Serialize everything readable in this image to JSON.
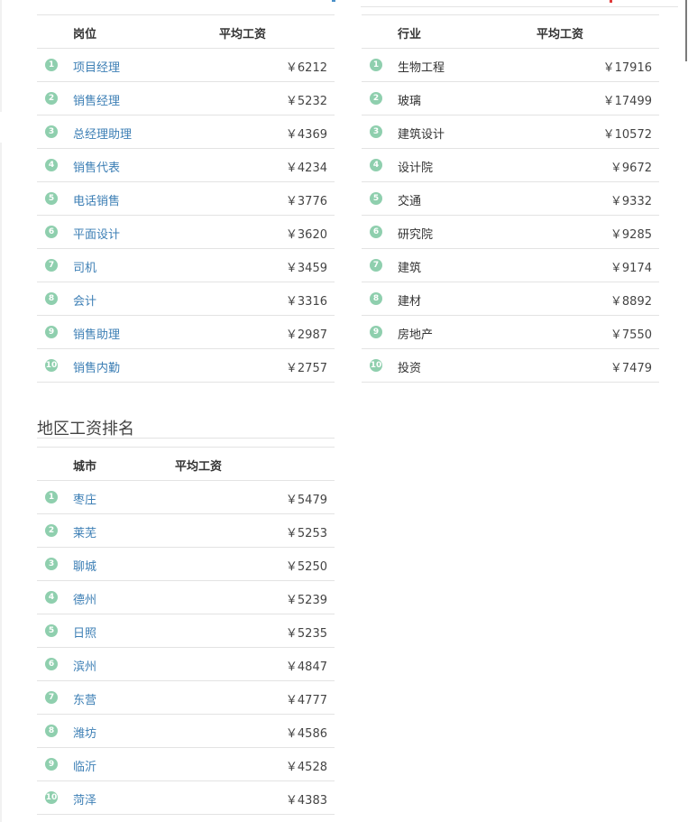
{
  "positions": {
    "col_name": "岗位",
    "col_salary": "平均工资",
    "rows": [
      {
        "rank": "1",
        "name": "项目经理",
        "salary": "￥6212"
      },
      {
        "rank": "2",
        "name": "销售经理",
        "salary": "￥5232"
      },
      {
        "rank": "3",
        "name": "总经理助理",
        "salary": "￥4369"
      },
      {
        "rank": "4",
        "name": "销售代表",
        "salary": "￥4234"
      },
      {
        "rank": "5",
        "name": "电话销售",
        "salary": "￥3776"
      },
      {
        "rank": "6",
        "name": "平面设计",
        "salary": "￥3620"
      },
      {
        "rank": "7",
        "name": "司机",
        "salary": "￥3459"
      },
      {
        "rank": "8",
        "name": "会计",
        "salary": "￥3316"
      },
      {
        "rank": "9",
        "name": "销售助理",
        "salary": "￥2987"
      },
      {
        "rank": "10",
        "name": "销售内勤",
        "salary": "￥2757"
      }
    ]
  },
  "industries": {
    "col_name": "行业",
    "col_salary": "平均工资",
    "rows": [
      {
        "rank": "1",
        "name": "生物工程",
        "salary": "￥17916"
      },
      {
        "rank": "2",
        "name": "玻璃",
        "salary": "￥17499"
      },
      {
        "rank": "3",
        "name": "建筑设计",
        "salary": "￥10572"
      },
      {
        "rank": "4",
        "name": "设计院",
        "salary": "￥9672"
      },
      {
        "rank": "5",
        "name": "交通",
        "salary": "￥9332"
      },
      {
        "rank": "6",
        "name": "研究院",
        "salary": "￥9285"
      },
      {
        "rank": "7",
        "name": "建筑",
        "salary": "￥9174"
      },
      {
        "rank": "8",
        "name": "建材",
        "salary": "￥8892"
      },
      {
        "rank": "9",
        "name": "房地产",
        "salary": "￥7550"
      },
      {
        "rank": "10",
        "name": "投资",
        "salary": "￥7479"
      }
    ]
  },
  "regions": {
    "title": "地区工资排名",
    "col_name": "城市",
    "col_salary": "平均工资",
    "rows": [
      {
        "rank": "1",
        "name": "枣庄",
        "salary": "￥5479"
      },
      {
        "rank": "2",
        "name": "莱芜",
        "salary": "￥5253"
      },
      {
        "rank": "3",
        "name": "聊城",
        "salary": "￥5250"
      },
      {
        "rank": "4",
        "name": "德州",
        "salary": "￥5239"
      },
      {
        "rank": "5",
        "name": "日照",
        "salary": "￥5235"
      },
      {
        "rank": "6",
        "name": "滨州",
        "salary": "￥4847"
      },
      {
        "rank": "7",
        "name": "东营",
        "salary": "￥4777"
      },
      {
        "rank": "8",
        "name": "潍坊",
        "salary": "￥4586"
      },
      {
        "rank": "9",
        "name": "临沂",
        "salary": "￥4528"
      },
      {
        "rank": "10",
        "name": "菏泽",
        "salary": "￥4383"
      }
    ]
  },
  "colors": {
    "rank_badge": "#8fcfae",
    "link": "#3d7fb5"
  }
}
